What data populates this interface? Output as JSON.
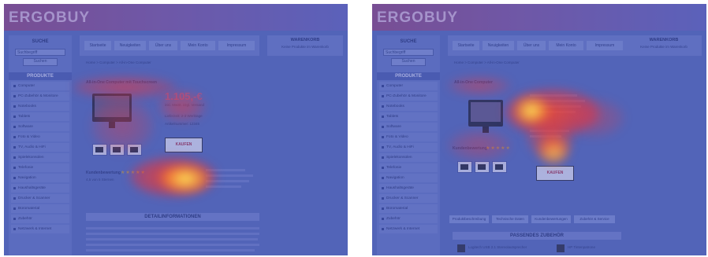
{
  "brand": {
    "logo": "ERGOBUY"
  },
  "sidebar": {
    "search_title": "SUCHE",
    "search_placeholder": "Suchbegriff",
    "search_button": "Suchen",
    "products_title": "PRODUKTE",
    "items": [
      {
        "label": "Computer"
      },
      {
        "label": "PC-Zubehör & Monitore"
      },
      {
        "label": "Notebooks"
      },
      {
        "label": "Tablets"
      },
      {
        "label": "Software"
      },
      {
        "label": "Foto & Video"
      },
      {
        "label": "TV, Audio & HiFi"
      },
      {
        "label": "Spielekonsolen"
      },
      {
        "label": "Telefonie"
      },
      {
        "label": "Navigation"
      },
      {
        "label": "Haushaltsgeräte"
      },
      {
        "label": "Drucker & Scanner"
      },
      {
        "label": "Büromaterial"
      },
      {
        "label": "Zubehör"
      },
      {
        "label": "Netzwerk & Internet"
      }
    ]
  },
  "nav": {
    "tabs": [
      {
        "label": "Startseite"
      },
      {
        "label": "Neuigkeiten"
      },
      {
        "label": "Über uns"
      },
      {
        "label": "Mein Konto"
      },
      {
        "label": "Impressum"
      }
    ]
  },
  "cart": {
    "title": "WARENKORB",
    "text": "Keine Produkte im Warenkorb"
  },
  "left": {
    "breadcrumb": "Home > Computer > All-in-One Computer",
    "product_title": "All-in-One Computer mit Touchscreen",
    "price": "1.105,-€",
    "price_note": "inkl. MwSt. zzgl. Versand",
    "info1": "Lieferzeit: 2-3 Werktage",
    "info2": "Artikelnummer: 12345",
    "cart_button": "KAUFEN",
    "rating_label": "Kundenbewertung",
    "stars": "★★★★★",
    "rating_text": "4,5 von 5 Sternen",
    "details_title": "DETAILINFORMATIONEN"
  },
  "right": {
    "breadcrumb": "Home > Computer > All-in-One Computer",
    "product_title": "All-in-One Computer",
    "cart_button": "KAUFEN",
    "rating_label": "Kundenbewertung",
    "stars": "★★★★★",
    "tabs": [
      {
        "label": "Produktbeschreibung"
      },
      {
        "label": "Technische Daten"
      },
      {
        "label": "Kundenbewertungen"
      },
      {
        "label": "Zubehör & Service"
      }
    ],
    "accessories_title": "PASSENDES ZUBEHÖR",
    "acc1": "Logitech USB 2.1 Stereolautsprecher",
    "acc2": "HP Tintenpatrone"
  },
  "heatmap": {
    "hot": "#ffe04a",
    "warm": "#ff3b2a",
    "base": "#5a6fb4"
  }
}
